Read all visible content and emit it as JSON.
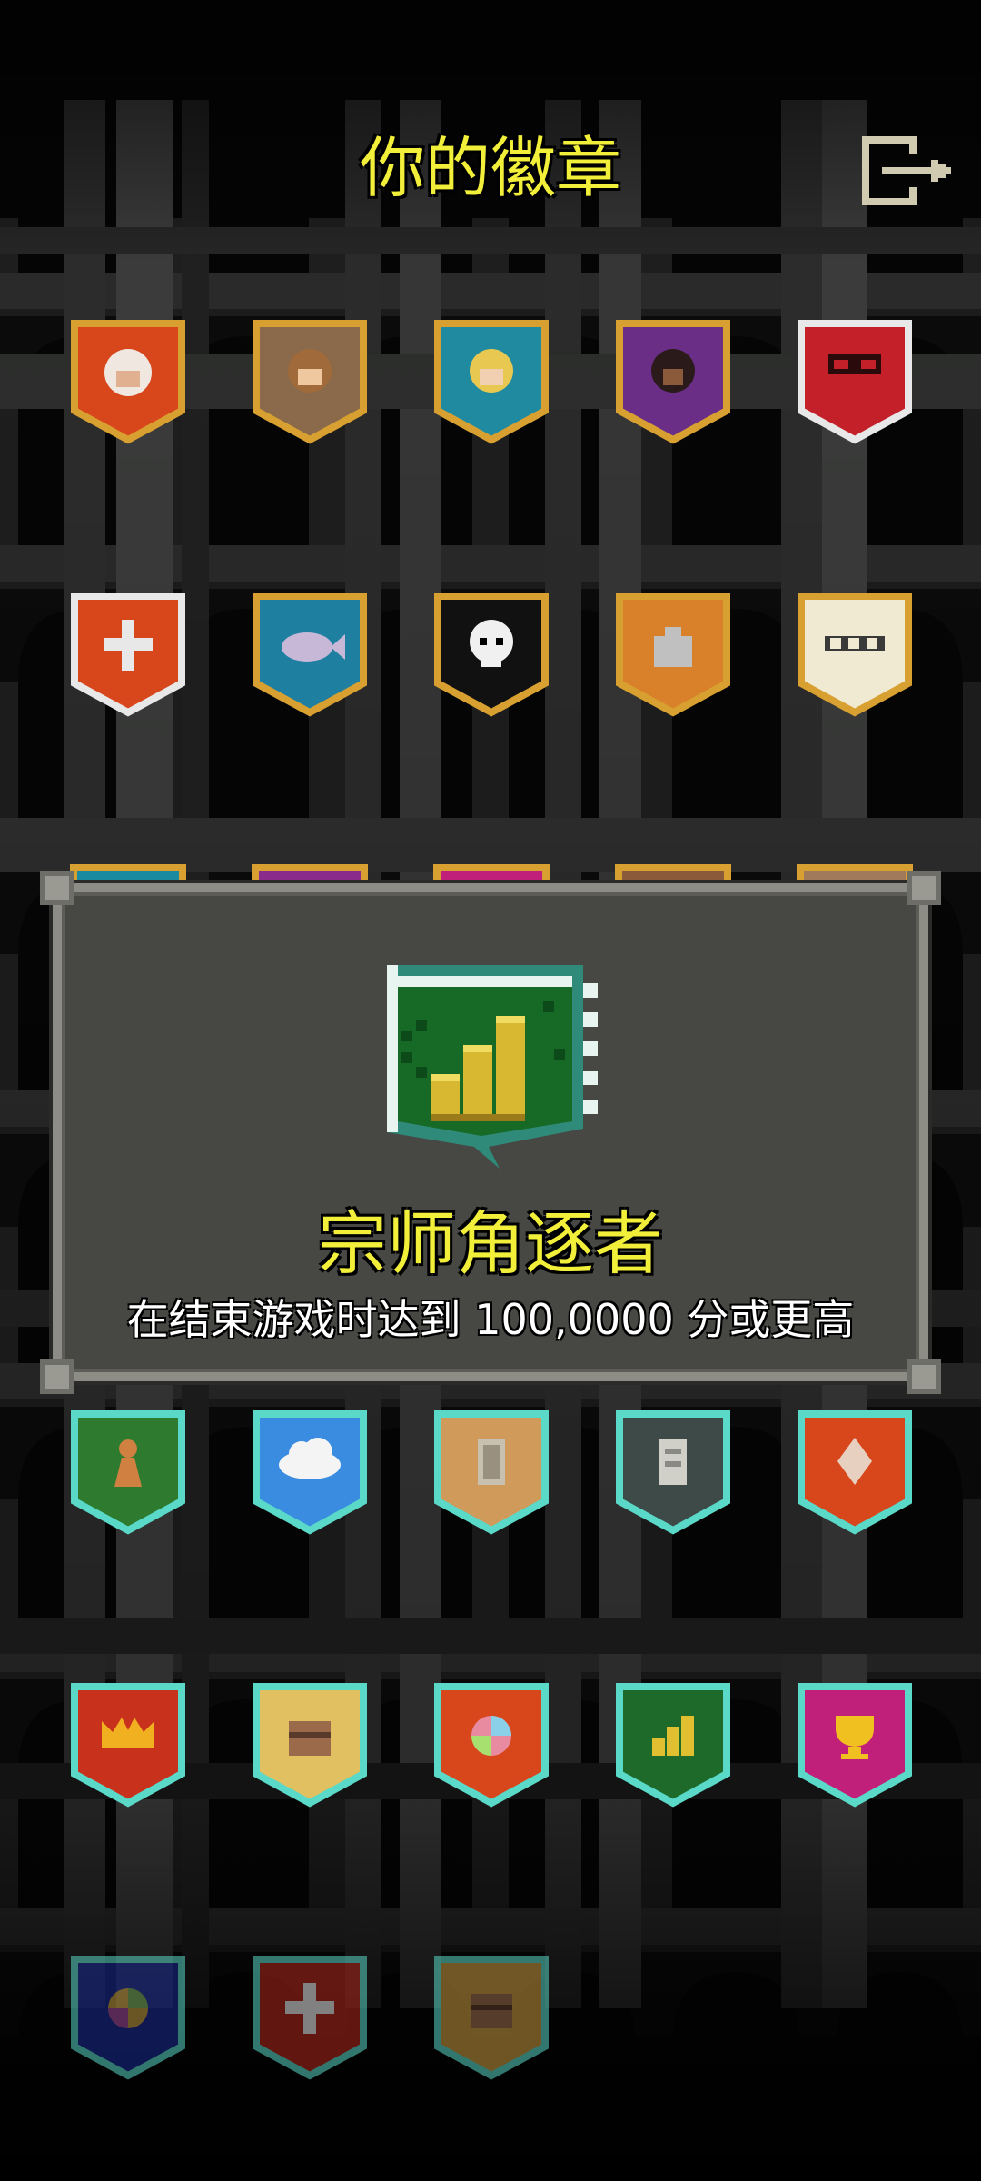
{
  "header": {
    "title": "你的徽章",
    "exit_icon": "exit-door-icon"
  },
  "badges": [
    {
      "icon": "warrior-portrait-icon",
      "frame": "gold",
      "color": "#d8461c",
      "state": "earned"
    },
    {
      "icon": "mage-portrait-icon",
      "frame": "gold",
      "color": "#8a6a4a",
      "state": "earned"
    },
    {
      "icon": "rogue-portrait-icon",
      "frame": "gold",
      "color": "#1f8aa0",
      "state": "earned"
    },
    {
      "icon": "huntress-portrait-icon",
      "frame": "gold",
      "color": "#6a2e86",
      "state": "earned"
    },
    {
      "icon": "masked-face-icon",
      "frame": "silver",
      "color": "#c4202a",
      "state": "earned"
    },
    {
      "icon": "cross-icon",
      "frame": "silver",
      "color": "#d8461c",
      "state": "earned"
    },
    {
      "icon": "fish-icon",
      "frame": "gold",
      "color": "#1f7fa0",
      "state": "earned"
    },
    {
      "icon": "skull-icon",
      "frame": "gold",
      "color": "#111111",
      "state": "earned"
    },
    {
      "icon": "bag-icon",
      "frame": "gold",
      "color": "#d8802a",
      "state": "earned"
    },
    {
      "icon": "teeth-icon",
      "frame": "gold",
      "color": "#f0ead2",
      "state": "earned"
    },
    {
      "icon": "pawn-icon",
      "frame": "cyan",
      "color": "#2e7a2e",
      "state": "earned"
    },
    {
      "icon": "cloud-icon",
      "frame": "cyan",
      "color": "#3a8ce0",
      "state": "earned"
    },
    {
      "icon": "door-icon",
      "frame": "cyan",
      "color": "#d09a5a",
      "state": "earned"
    },
    {
      "icon": "stone-door-icon",
      "frame": "cyan",
      "color": "#3e4a48",
      "state": "earned"
    },
    {
      "icon": "diamond-icon",
      "frame": "cyan",
      "color": "#d8461c",
      "state": "earned"
    },
    {
      "icon": "crown-icon",
      "frame": "cyan",
      "color": "#c8321c",
      "state": "earned"
    },
    {
      "icon": "chest-icon",
      "frame": "cyan",
      "color": "#e0c060",
      "state": "earned"
    },
    {
      "icon": "rainbow-orb-icon",
      "frame": "cyan",
      "color": "#d8461c",
      "state": "earned"
    },
    {
      "icon": "bar-chart-icon",
      "frame": "cyan",
      "color": "#1e6a2a",
      "state": "earned"
    },
    {
      "icon": "trophy-icon",
      "frame": "cyan",
      "color": "#c0207a",
      "state": "earned"
    },
    {
      "icon": "globe-icon",
      "frame": "cyan",
      "color": "#1a2a90",
      "state": "locked"
    },
    {
      "icon": "cross-icon",
      "frame": "cyan",
      "color": "#b0281c",
      "state": "locked"
    },
    {
      "icon": "chest-icon",
      "frame": "cyan",
      "color": "#c89a40",
      "state": "locked"
    }
  ],
  "dialog": {
    "icon": "bar-chart-icon",
    "title": "宗师角逐者",
    "description": "在结束游戏时达到 100,0000 分或更高",
    "accent": "#f2ef3a"
  }
}
